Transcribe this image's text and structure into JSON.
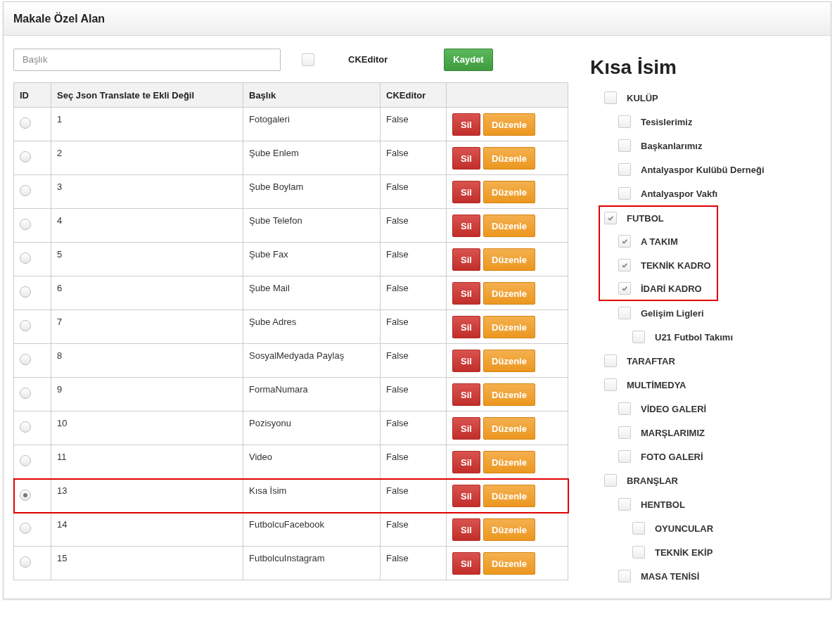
{
  "panel": {
    "title": "Makale Özel Alan"
  },
  "form": {
    "title_field": {
      "placeholder": "Başlık"
    },
    "ckeditor": {
      "label": "CKEditor",
      "checked": false
    },
    "save_button": "Kaydet"
  },
  "table": {
    "columns": [
      "ID",
      "Seç Json Translate te Ekli Değil",
      "Başlık",
      "CKEditor"
    ],
    "rows": [
      {
        "id": "1",
        "title": "Fotogaleri",
        "ckeditor": "False",
        "selected": false,
        "highlighted": false,
        "delete": "Sil",
        "edit": "Düzenle"
      },
      {
        "id": "2",
        "title": "Şube Enlem",
        "ckeditor": "False",
        "selected": false,
        "highlighted": false,
        "delete": "Sil",
        "edit": "Düzenle"
      },
      {
        "id": "3",
        "title": "Şube Boylam",
        "ckeditor": "False",
        "selected": false,
        "highlighted": false,
        "delete": "Sil",
        "edit": "Düzenle"
      },
      {
        "id": "4",
        "title": "Şube Telefon",
        "ckeditor": "False",
        "selected": false,
        "highlighted": false,
        "delete": "Sil",
        "edit": "Düzenle"
      },
      {
        "id": "5",
        "title": "Şube Fax",
        "ckeditor": "False",
        "selected": false,
        "highlighted": false,
        "delete": "Sil",
        "edit": "Düzenle"
      },
      {
        "id": "6",
        "title": "Şube Mail",
        "ckeditor": "False",
        "selected": false,
        "highlighted": false,
        "delete": "Sil",
        "edit": "Düzenle"
      },
      {
        "id": "7",
        "title": "Şube Adres",
        "ckeditor": "False",
        "selected": false,
        "highlighted": false,
        "delete": "Sil",
        "edit": "Düzenle"
      },
      {
        "id": "8",
        "title": "SosyalMedyada Paylaş",
        "ckeditor": "False",
        "selected": false,
        "highlighted": false,
        "delete": "Sil",
        "edit": "Düzenle"
      },
      {
        "id": "9",
        "title": "FormaNumara",
        "ckeditor": "False",
        "selected": false,
        "highlighted": false,
        "delete": "Sil",
        "edit": "Düzenle"
      },
      {
        "id": "10",
        "title": "Pozisyonu",
        "ckeditor": "False",
        "selected": false,
        "highlighted": false,
        "delete": "Sil",
        "edit": "Düzenle"
      },
      {
        "id": "11",
        "title": "Video",
        "ckeditor": "False",
        "selected": false,
        "highlighted": false,
        "delete": "Sil",
        "edit": "Düzenle"
      },
      {
        "id": "13",
        "title": "Kısa İsim",
        "ckeditor": "False",
        "selected": true,
        "highlighted": true,
        "delete": "Sil",
        "edit": "Düzenle"
      },
      {
        "id": "14",
        "title": "FutbolcuFacebook",
        "ckeditor": "False",
        "selected": false,
        "highlighted": false,
        "delete": "Sil",
        "edit": "Düzenle"
      },
      {
        "id": "15",
        "title": "FutbolcuInstagram",
        "ckeditor": "False",
        "selected": false,
        "highlighted": false,
        "delete": "Sil",
        "edit": "Düzenle"
      }
    ]
  },
  "tree": {
    "title": "Kısa İsim",
    "items": [
      {
        "label": "KULÜP",
        "checked": false,
        "highlighted": false,
        "children": [
          {
            "label": "Tesislerimiz",
            "checked": false,
            "highlighted": false
          },
          {
            "label": "Başkanlarımız",
            "checked": false,
            "highlighted": false
          },
          {
            "label": "Antalyaspor Kulübü Derneği",
            "checked": false,
            "highlighted": false
          },
          {
            "label": "Antalyaspor Vakfı",
            "checked": false,
            "highlighted": false
          }
        ]
      },
      {
        "label": "FUTBOL",
        "checked": true,
        "highlighted": true,
        "children": [
          {
            "label": "A TAKIM",
            "checked": true,
            "highlighted": true
          },
          {
            "label": "TEKNİK KADRO",
            "checked": true,
            "highlighted": true
          },
          {
            "label": "İDARİ KADRO",
            "checked": true,
            "highlighted": true
          },
          {
            "label": "Gelişim Ligleri",
            "checked": false,
            "highlighted": false,
            "children": [
              {
                "label": "U21 Futbol Takımı",
                "checked": false,
                "highlighted": false
              }
            ]
          }
        ]
      },
      {
        "label": "TARAFTAR",
        "checked": false,
        "highlighted": false
      },
      {
        "label": "MULTİMEDYA",
        "checked": false,
        "highlighted": false,
        "children": [
          {
            "label": "VİDEO GALERİ",
            "checked": false,
            "highlighted": false
          },
          {
            "label": "MARŞLARIMIZ",
            "checked": false,
            "highlighted": false
          },
          {
            "label": "FOTO GALERİ",
            "checked": false,
            "highlighted": false
          }
        ]
      },
      {
        "label": "BRANŞLAR",
        "checked": false,
        "highlighted": false,
        "children": [
          {
            "label": "HENTBOL",
            "checked": false,
            "highlighted": false,
            "children": [
              {
                "label": "OYUNCULAR",
                "checked": false,
                "highlighted": false
              },
              {
                "label": "TEKNİK EKİP",
                "checked": false,
                "highlighted": false
              }
            ]
          },
          {
            "label": "MASA TENİSİ",
            "checked": false,
            "highlighted": false
          }
        ]
      }
    ]
  }
}
